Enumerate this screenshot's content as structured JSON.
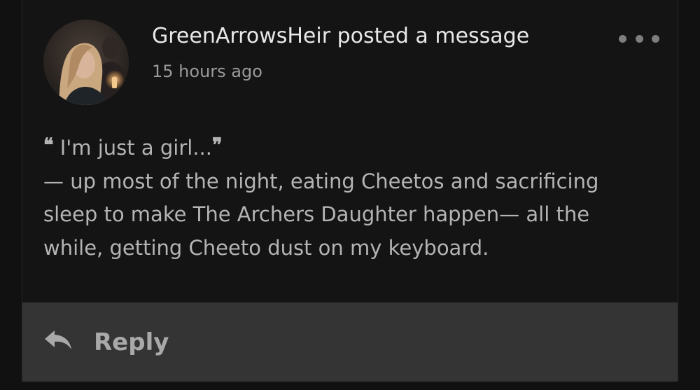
{
  "post": {
    "author": "GreenArrowsHeir",
    "action": "posted a message",
    "timestamp": "15 hours ago",
    "avatar_icon": "profile-photo-avatar",
    "menu_icon": "more-options-dots-icon"
  },
  "message": {
    "open_quote": "❝",
    "quote": "I'm just a girl...",
    "close_quote": "❞",
    "lines": [
      "— up most of the night, eating Cheetos and sacrificing",
      "sleep to make The Archers Daughter happen— all the",
      "while, getting Cheeto dust on my keyboard."
    ]
  },
  "reply": {
    "label": "Reply",
    "icon": "reply-arrow-icon"
  },
  "colors": {
    "background": "#111111",
    "card": "#141414",
    "reply_bar": "#343434",
    "title_text": "#e8e8e8",
    "body_text": "#b4b4b4",
    "muted_text": "#9a9a9a"
  }
}
